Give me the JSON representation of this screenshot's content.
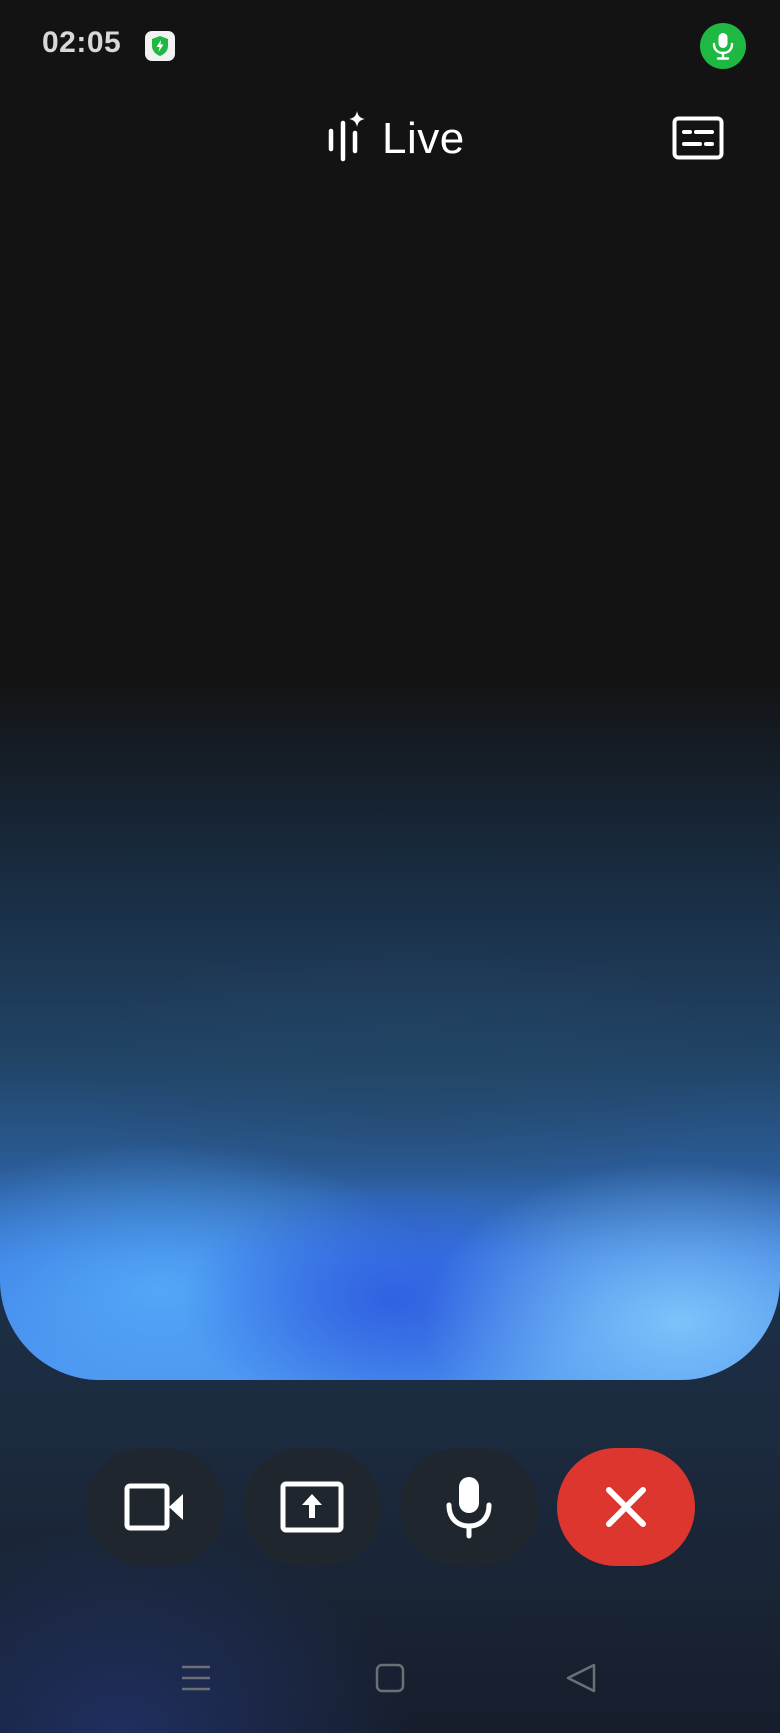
{
  "status_bar": {
    "time": "02:05",
    "shield_icon": "shield-charging-icon",
    "mic_indicator_icon": "mic-icon",
    "mic_indicator_color": "#1fb842"
  },
  "header": {
    "title": "Live",
    "title_icon": "live-sparkle-icon",
    "captions_icon": "captions-icon"
  },
  "controls": {
    "camera_icon": "video-camera-icon",
    "share_icon": "screen-share-icon",
    "mic_icon": "mic-icon",
    "end_icon": "close-icon",
    "end_color": "#dc362e"
  },
  "nav_bar": {
    "menu_icon": "menu-lines-icon",
    "home_icon": "home-square-icon",
    "back_icon": "back-triangle-icon"
  },
  "colors": {
    "background": "#131314",
    "glow_blue": "#3a7ae0",
    "glow_light": "#8cd2ff"
  }
}
